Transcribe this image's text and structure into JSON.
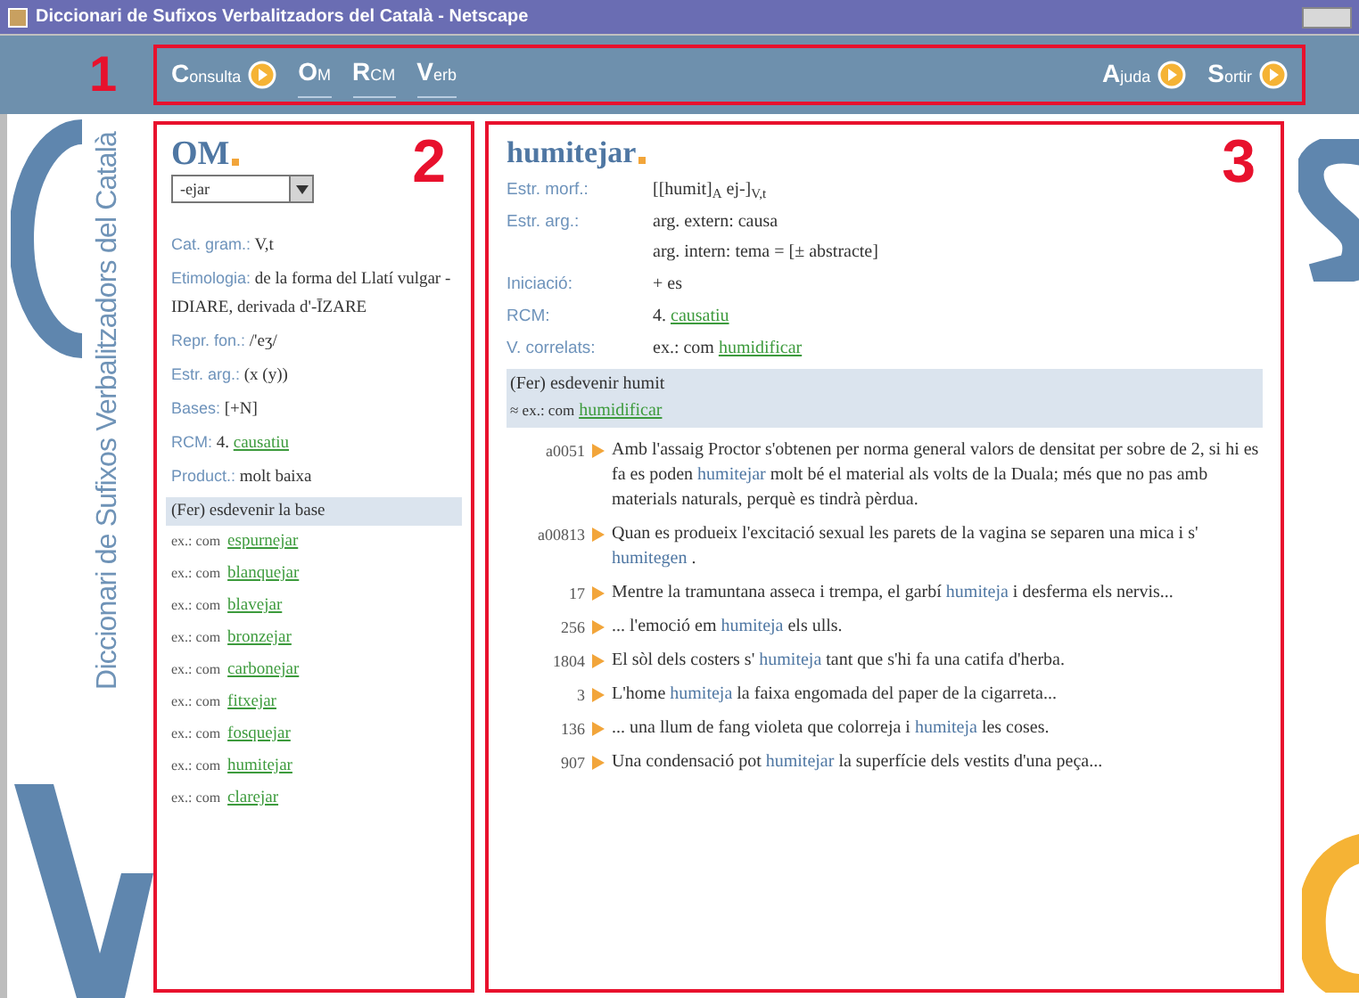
{
  "window": {
    "title": "Diccionari de Sufixos Verbalitzadors del Català - Netscape"
  },
  "toolbar": {
    "callout": "1",
    "left": [
      {
        "kind": "arrow",
        "label": "Consulta"
      },
      {
        "kind": "tab",
        "label": "OM"
      },
      {
        "kind": "tab",
        "label": "RCM"
      },
      {
        "kind": "tab",
        "label": "Verb"
      }
    ],
    "right": [
      {
        "kind": "arrow",
        "label": "Ajuda"
      },
      {
        "kind": "arrow",
        "label": "Sortir"
      }
    ]
  },
  "brand": {
    "vertical_title": "Diccionari de Sufixos Verbalitzadors del Català"
  },
  "left_panel": {
    "callout": "2",
    "title": "OM",
    "select": {
      "value": "-ejar"
    },
    "fields": [
      {
        "label": "Cat. gram.:",
        "text": "V,t"
      },
      {
        "label": "Etimologia:",
        "text": "de la forma del Llatí vulgar -IDIARE, derivada d'-ĪZARE"
      },
      {
        "label": "Repr. fon.:",
        "text": "/'eʒ/"
      },
      {
        "label": "Estr. arg.:",
        "text": "(x (y))"
      },
      {
        "label": "Bases:",
        "text": "[+N]"
      },
      {
        "label": "RCM:",
        "text": "4.",
        "link": "causatiu"
      },
      {
        "label": "Product.:",
        "text": "molt baixa"
      }
    ],
    "sense": "(Fer) esdevenir la base",
    "examples": [
      {
        "prefix": "ex.: com",
        "link": "espurnejar"
      },
      {
        "prefix": "ex.: com",
        "link": "blanquejar"
      },
      {
        "prefix": "ex.: com",
        "link": "blavejar"
      },
      {
        "prefix": "ex.: com",
        "link": "bronzejar"
      },
      {
        "prefix": "ex.: com",
        "link": "carbonejar"
      },
      {
        "prefix": "ex.: com",
        "link": "fitxejar"
      },
      {
        "prefix": "ex.: com",
        "link": "fosquejar"
      },
      {
        "prefix": "ex.: com",
        "link": "humitejar"
      },
      {
        "prefix": "ex.: com",
        "link": "clarejar"
      }
    ]
  },
  "right_panel": {
    "callout": "3",
    "title": "humitejar",
    "fields": [
      {
        "label": "Estr. morf.:",
        "lines": [
          {
            "text": "[[humit]$_{A}$ ej-]$_{V,t}$"
          }
        ]
      },
      {
        "label": "Estr. arg.:",
        "lines": [
          {
            "text": "arg. extern: causa"
          },
          {
            "text": "arg. intern: tema = [± abstracte]"
          }
        ]
      },
      {
        "label": "Iniciació:",
        "lines": [
          {
            "text": "+ es"
          }
        ]
      },
      {
        "label": "RCM:",
        "lines": [
          {
            "text": "4.",
            "link": "causatiu"
          }
        ]
      },
      {
        "label": "V. correlats:",
        "lines": [
          {
            "text": "ex.: com",
            "link": "humidificar"
          }
        ]
      }
    ],
    "sense": {
      "text": "(Fer) esdevenir humit",
      "prefix": "≈ ex.: com",
      "link": "humidificar"
    },
    "examples": [
      {
        "num": "a0051",
        "before": "Amb l'assaig Proctor s'obtenen per norma general valors de densitat per sobre de 2, si hi es fa es poden",
        "word": "humitejar",
        "after": "molt bé el material als volts de la Duala; més que no pas amb materials naturals, perquè es tindrà pèrdua."
      },
      {
        "num": "a00813",
        "before": "Quan es produeix l'excitació sexual les parets de la vagina se separen una mica i s'",
        "word": "humitegen",
        "after": "."
      },
      {
        "num": "17",
        "before": "Mentre la tramuntana asseca i trempa, el garbí",
        "word": "humiteja",
        "after": "i desferma els nervis..."
      },
      {
        "num": "256",
        "before": "... l'emoció em",
        "word": "humiteja",
        "after": "els ulls."
      },
      {
        "num": "1804",
        "before": "El sòl dels costers s'",
        "word": "humiteja",
        "after": "tant que s'hi fa una catifa d'herba."
      },
      {
        "num": "3",
        "before": "L'home",
        "word": "humiteja",
        "after": "la faixa engomada del paper de la cigarreta..."
      },
      {
        "num": "136",
        "before": "... una llum de fang violeta que colorreja i",
        "word": "humiteja",
        "after": "les coses."
      },
      {
        "num": "907",
        "before": "Una condensació pot",
        "word": "humitejar",
        "after": "la superfície dels vestits d'una peça..."
      }
    ]
  }
}
